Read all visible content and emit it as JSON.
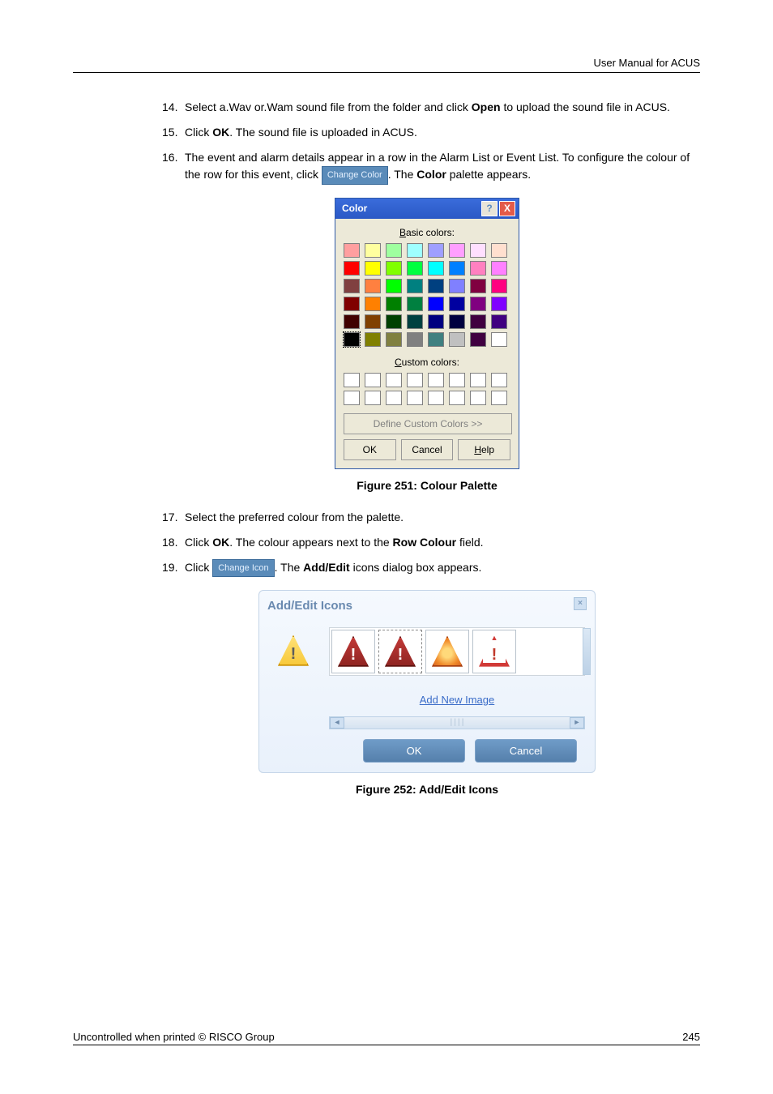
{
  "header": {
    "right": "User Manual for ACUS"
  },
  "list": {
    "n14": "14.",
    "t14a": "Select a.Wav or.Wam sound file from the folder and click ",
    "t14b": "Open",
    "t14c": " to upload the sound file in ACUS.",
    "n15": "15.",
    "t15a": "Click ",
    "t15b": "OK",
    "t15c": ". The sound file is uploaded in ACUS.",
    "n16": "16.",
    "t16a": "The event and alarm details appear in a row in the Alarm List or Event List. To configure the colour of the row for this event, click ",
    "t16btn": "Change Color",
    "t16b": ". The ",
    "t16c": "Color",
    "t16d": " palette appears.",
    "n17": "17.",
    "t17": "Select the preferred colour from the palette.",
    "n18": "18.",
    "t18a": "Click ",
    "t18b": "OK",
    "t18c": ". The colour appears next to the ",
    "t18d": "Row Colour",
    "t18e": " field.",
    "n19": "19.",
    "t19a": "Click ",
    "t19btn": "Change Icon",
    "t19b": ". The ",
    "t19c": "Add/Edit",
    "t19d": " icons dialog box appears."
  },
  "colorDialog": {
    "title": "Color",
    "help": "?",
    "close": "X",
    "basic_label_u": "B",
    "basic_label_rest": "asic colors:",
    "custom_label_u": "C",
    "custom_label_rest": "ustom colors:",
    "define_u": "D",
    "define_rest": "efine Custom Colors >>",
    "ok": "OK",
    "cancel": "Cancel",
    "help_btn_u": "H",
    "help_btn_rest": "elp",
    "basic_colors": [
      "#ff9f9f",
      "#ffff9f",
      "#9fff9f",
      "#9fffff",
      "#9f9fff",
      "#ff9fff",
      "#ffdfff",
      "#ffdfcf",
      "#ff0000",
      "#ffff00",
      "#80ff00",
      "#00ff40",
      "#00ffff",
      "#0080ff",
      "#ff80c0",
      "#ff80ff",
      "#804040",
      "#ff8040",
      "#00ff00",
      "#008080",
      "#004080",
      "#8080ff",
      "#800040",
      "#ff0080",
      "#800000",
      "#ff8000",
      "#008000",
      "#008040",
      "#0000ff",
      "#0000a0",
      "#800080",
      "#8000ff",
      "#400000",
      "#804000",
      "#004000",
      "#004040",
      "#000080",
      "#000040",
      "#400040",
      "#400080",
      "#000000",
      "#808000",
      "#808040",
      "#808080",
      "#408080",
      "#c0c0c0",
      "#400040",
      "#ffffff"
    ]
  },
  "figCaption1": "Figure 251: Colour Palette",
  "aeDialog": {
    "title": "Add/Edit Icons",
    "add_link": "Add New Image",
    "ok": "OK",
    "cancel": "Cancel"
  },
  "figCaption2": "Figure 252: Add/Edit Icons",
  "footer": {
    "left": "Uncontrolled when printed © RISCO Group",
    "right": "245"
  }
}
